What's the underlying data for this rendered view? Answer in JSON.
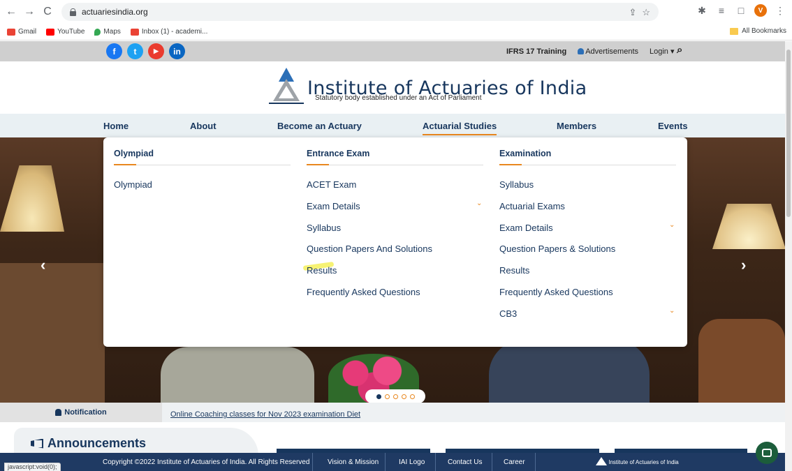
{
  "browser": {
    "url": "actuariesindia.org",
    "bookmarks": [
      {
        "label": "Gmail",
        "color": "#ea4335"
      },
      {
        "label": "YouTube",
        "color": "#ff0000"
      },
      {
        "label": "Maps",
        "color": "#34a853"
      },
      {
        "label": "Inbox (1) - academi...",
        "color": "#ea4335"
      }
    ],
    "all_bookmarks": "All Bookmarks",
    "avatar_letter": "V",
    "status_url": "javascript:void(0);"
  },
  "topbar": {
    "social": [
      {
        "name": "facebook-icon",
        "glyph": "f",
        "color": "#1877f2"
      },
      {
        "name": "twitter-icon",
        "glyph": "t",
        "color": "#1da1f2"
      },
      {
        "name": "youtube-icon",
        "glyph": "▶",
        "color": "#ff0000"
      },
      {
        "name": "linkedin-icon",
        "glyph": "in",
        "color": "#0a66c2"
      }
    ],
    "ifrs": "IFRS 17 Training",
    "advertisements": "Advertisements",
    "login": "Login ▾"
  },
  "header": {
    "title": "Institute of Actuaries of India",
    "subtitle": "Statutory body established under an Act of Parliament"
  },
  "nav": {
    "items": [
      "Home",
      "About",
      "Become an Actuary",
      "Actuarial Studies",
      "Members",
      "Events"
    ],
    "active": "Actuarial Studies"
  },
  "dropdown": {
    "columns": [
      {
        "heading": "Olympiad",
        "items": [
          "Olympiad"
        ]
      },
      {
        "heading": "Entrance Exam",
        "items": [
          "ACET Exam",
          "Exam Details",
          "Syllabus",
          "Question Papers And Solutions",
          "Results",
          "Frequently Asked Questions"
        ]
      },
      {
        "heading": "Examination",
        "items": [
          "Syllabus",
          "Actuarial Exams",
          "Exam Details",
          "Question Papers & Solutions",
          "Results",
          "Frequently Asked Questions",
          "CB3"
        ]
      }
    ]
  },
  "notification": {
    "label": "Notification",
    "link": "Online Coaching classes for Nov 2023 examination Diet"
  },
  "announcements": {
    "title": "Announcements"
  },
  "footer": {
    "copyright": "Copyright ©2022 Institute of Actuaries of India. All Rights Reserved",
    "links": [
      "Vision & Mission",
      "IAI Logo",
      "Contact Us",
      "Career"
    ],
    "logo_text": "Institute of Actuaries of India"
  },
  "colors": {
    "brand_navy": "#17365d",
    "accent_orange": "#e8871e",
    "highlight_yellow": "#f5f05a"
  }
}
